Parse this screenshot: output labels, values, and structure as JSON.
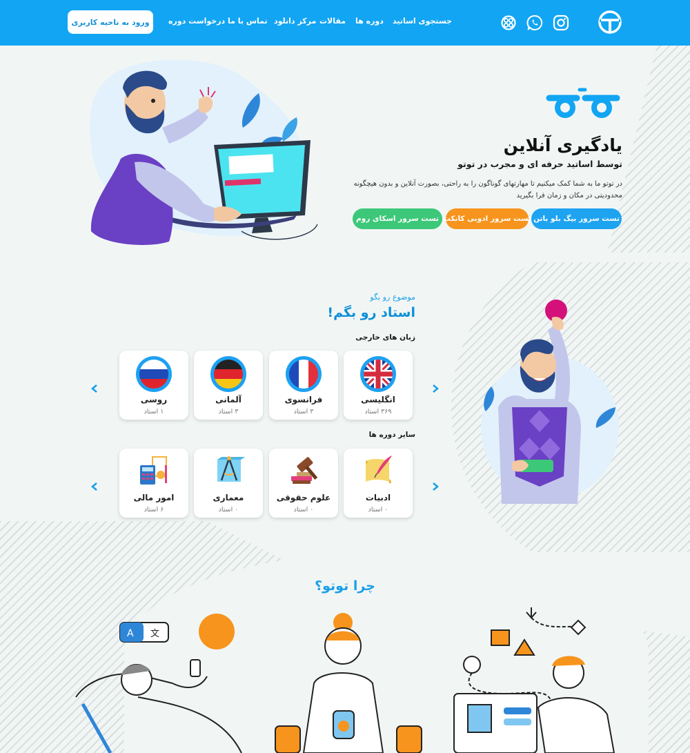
{
  "header": {
    "nav": [
      {
        "label": "جستجوی اساتید"
      },
      {
        "label": "دوره ها"
      },
      {
        "label": "مقالات"
      },
      {
        "label": "مرکز دانلود"
      },
      {
        "label": "تماس با ما"
      },
      {
        "label": "درخواست دوره"
      }
    ],
    "login_label": "ورود به ناحیه کاربری",
    "social_icons": [
      "aparat-icon",
      "whatsapp-icon",
      "instagram-icon"
    ]
  },
  "hero": {
    "title": "یادگیری آنلاین",
    "subtitle": "توسط اساتید حرفه ای و مجرب در توتو",
    "description": "در توتو ما به شما کمک میکنیم تا مهارتهای گوناگون را به راحتی، بصورت آنلاین و بدون هیچگونه محدودیتی در مکان و زمان فرا بگیرید",
    "buttons": [
      {
        "label": "تست سرور بیگ بلو باتن",
        "color": "#1ea3f1"
      },
      {
        "label": "تست سرور ادوبی کانکت",
        "color": "#f7941d"
      },
      {
        "label": "تست سرور اسکای روم",
        "color": "#3cc878"
      }
    ]
  },
  "categories": {
    "kicker": "موضوع رو بگو",
    "headline": "استاد رو بگم!",
    "languages_label": "زبان های خارجی",
    "languages": [
      {
        "name": "انگلیسی",
        "count": "۳۶۹ استاد",
        "flag": "uk-flag-icon"
      },
      {
        "name": "فرانسوی",
        "count": "۳ استاد",
        "flag": "france-flag-icon"
      },
      {
        "name": "آلمانی",
        "count": "۳ استاد",
        "flag": "germany-flag-icon"
      },
      {
        "name": "روسی",
        "count": "۱ استاد",
        "flag": "russia-flag-icon"
      }
    ],
    "other_label": "سایر دوره ها",
    "others": [
      {
        "name": "ادبیات",
        "count": "۰ استاد",
        "icon": "literature-icon"
      },
      {
        "name": "علوم حقوقی",
        "count": "۰ استاد",
        "icon": "gavel-icon"
      },
      {
        "name": "معماری",
        "count": "۰ استاد",
        "icon": "architecture-icon"
      },
      {
        "name": "امور مالی",
        "count": "۶ استاد",
        "icon": "finance-icon"
      }
    ]
  },
  "why": {
    "title": "چرا توتو؟"
  },
  "colors": {
    "brand_blue": "#12a5f3",
    "accent_orange": "#f7941d",
    "accent_green": "#3cc878"
  }
}
